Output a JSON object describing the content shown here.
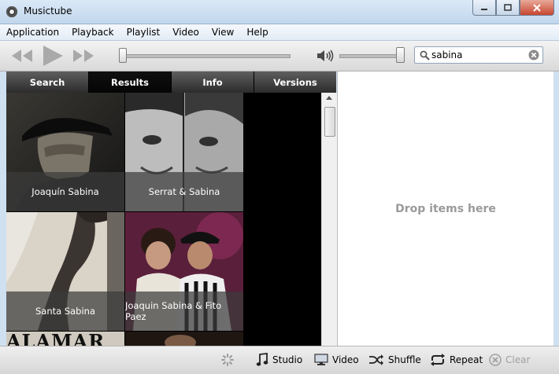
{
  "window": {
    "title": "Musictube"
  },
  "menu": [
    "Application",
    "Playback",
    "Playlist",
    "Video",
    "View",
    "Help"
  ],
  "player": {
    "seek_fraction": 0.0,
    "volume_fraction": 1.0
  },
  "search": {
    "value": "sabina"
  },
  "tabs": [
    {
      "label": "Search",
      "active": false
    },
    {
      "label": "Results",
      "active": true
    },
    {
      "label": "Info",
      "active": false
    },
    {
      "label": "Versions",
      "active": false
    }
  ],
  "results": [
    {
      "label": "Joaquín Sabina"
    },
    {
      "label": "Serrat & Sabina"
    },
    {
      "label": "Santa Sabina"
    },
    {
      "label": "Joaquin Sabina & Fito Paez"
    },
    {
      "label": ""
    }
  ],
  "partial_tile_text": "ALAMAR",
  "drop_area": {
    "text": "Drop items here"
  },
  "bottom": {
    "studio": "Studio",
    "video": "Video",
    "shuffle": "Shuffle",
    "repeat": "Repeat",
    "clear": "Clear"
  }
}
